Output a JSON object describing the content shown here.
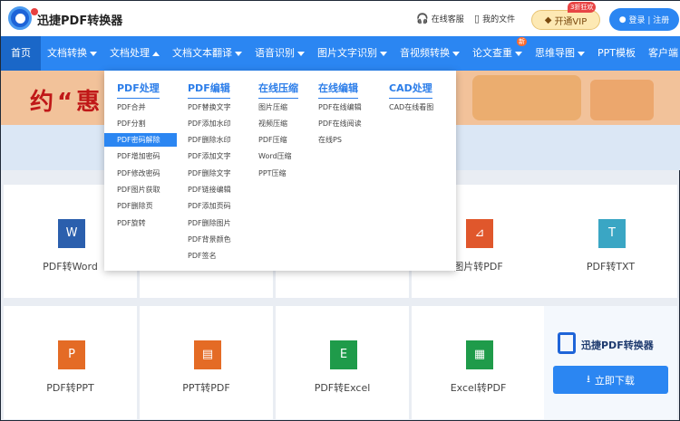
{
  "app": {
    "brand": "迅捷PDF转换器"
  },
  "header": {
    "service": "在线客服",
    "files": "我的文件",
    "vip_label": "开通VIP",
    "vip_badge": "3折狂欢",
    "login": "登录 | 注册"
  },
  "nav": {
    "items": [
      {
        "label": "首页",
        "active": true
      },
      {
        "label": "文档转换",
        "dropdown": true
      },
      {
        "label": "文档处理",
        "dropdown": true,
        "open": true
      },
      {
        "label": "文档文本翻译",
        "dropdown": true
      },
      {
        "label": "语音识别",
        "dropdown": true
      },
      {
        "label": "图片文字识别",
        "dropdown": true
      },
      {
        "label": "音视频转换",
        "dropdown": true
      },
      {
        "label": "论文查重",
        "dropdown": true,
        "badge": "新"
      },
      {
        "label": "思维导图",
        "dropdown": true
      },
      {
        "label": "PPT模板"
      },
      {
        "label": "客户端",
        "dropdown": true
      }
    ]
  },
  "banner": {
    "text": "约“惠"
  },
  "dropdown": {
    "columns": [
      {
        "title": "PDF处理",
        "items": [
          "PDF合并",
          "PDF分割",
          "PDF密码解除",
          "PDF增加密码",
          "PDF修改密码",
          "PDF图片获取",
          "PDF删除页",
          "PDF旋转"
        ],
        "selected": 2
      },
      {
        "title": "PDF编辑",
        "items": [
          "PDF替换文字",
          "PDF添加水印",
          "PDF删除水印",
          "PDF添加文字",
          "PDF删除文字",
          "PDF链接编辑",
          "PDF添加页码",
          "PDF删除图片",
          "PDF背景颜色",
          "PDF签名"
        ]
      },
      {
        "title": "在线压缩",
        "items": [
          "图片压缩",
          "视频压缩",
          "PDF压缩",
          "Word压缩",
          "PPT压缩"
        ]
      },
      {
        "title": "在线编辑",
        "items": [
          "PDF在线编辑",
          "PDF在线阅读",
          "在线PS"
        ]
      },
      {
        "title": "CAD处理",
        "items": [
          "CAD在线看图"
        ]
      }
    ]
  },
  "cards": {
    "row1": [
      {
        "label": "PDF转Word",
        "icon": "W",
        "color": "#2b5fad"
      },
      {
        "label": "",
        "icon": "",
        "color": "#ffffff"
      },
      {
        "label": "",
        "icon": "",
        "color": "#ffffff"
      },
      {
        "label": "图片转PDF",
        "icon": "⊿",
        "color": "#e0572c"
      },
      {
        "label": "PDF转TXT",
        "icon": "T",
        "color": "#3aa6c4"
      }
    ],
    "row2": [
      {
        "label": "PDF转PPT",
        "icon": "P",
        "color": "#e46b25"
      },
      {
        "label": "PPT转PDF",
        "icon": "▤",
        "color": "#e46b25"
      },
      {
        "label": "PDF转Excel",
        "icon": "E",
        "color": "#1f9b4a"
      },
      {
        "label": "Excel转PDF",
        "icon": "▦",
        "color": "#1f9b4a"
      }
    ]
  },
  "promo": {
    "app_name": "迅捷PDF转换器",
    "download": "立即下载"
  }
}
